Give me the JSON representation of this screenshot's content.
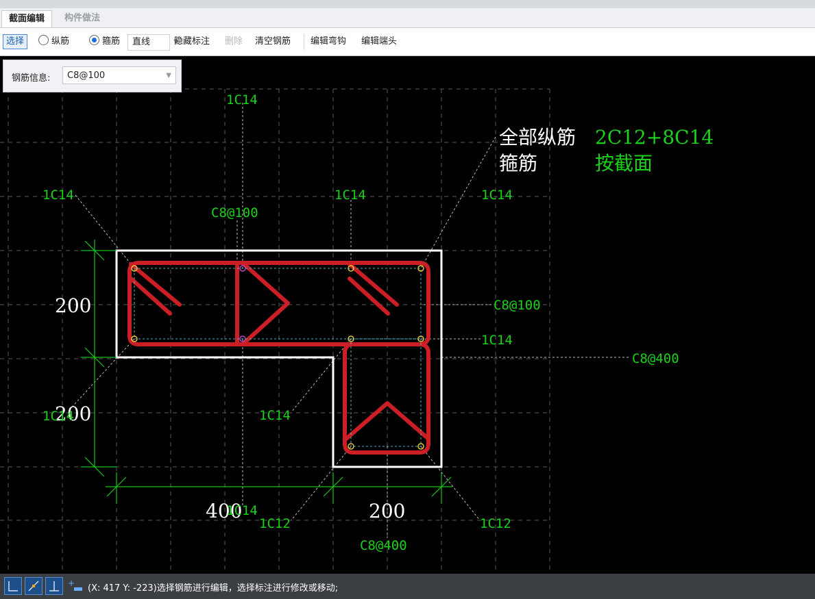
{
  "tabs": [
    {
      "label": "截面编辑",
      "active": true
    },
    {
      "label": "构件做法",
      "active": false
    }
  ],
  "toolbar": {
    "select_label": "选择",
    "radio_long_label": "纵筋",
    "radio_stirrup_label": "箍筋",
    "line_type_value": "直线",
    "hide_annotation_label": "隐藏标注",
    "delete_label": "删除",
    "clear_rebar_label": "清空钢筋",
    "edit_hook_label": "编辑弯钩",
    "edit_end_label": "编辑端头"
  },
  "info_panel": {
    "label": "钢筋信息:",
    "value": "C8@100"
  },
  "drawing": {
    "summary": {
      "all_long_label": "全部纵筋",
      "all_long_value": "2C12+8C14",
      "stirrup_label": "箍筋",
      "stirrup_value": "按截面"
    },
    "dims": {
      "top_left_200": "200",
      "left_lower_200": "200",
      "bottom_400": "400",
      "bottom_200": "200"
    },
    "labels": {
      "a": "1C14",
      "b": "1C14",
      "c": "1C14",
      "d": "1C14",
      "e": "1C14",
      "f": "1C14",
      "g": "1C14",
      "h": "1C14",
      "i": "1C12",
      "j": "1C12",
      "s1": "C8@100",
      "s2": "C8@100",
      "s3": "C8@400",
      "s4": "C8@400"
    },
    "colors": {
      "rebar": "#cc1f25",
      "annotation": "#19d219",
      "outline": "#ffffff",
      "dims": "#19c419"
    }
  },
  "statusbar": {
    "text": "(X: 417 Y: -223)选择钢筋进行编辑，选择标注进行修改或移动;"
  }
}
